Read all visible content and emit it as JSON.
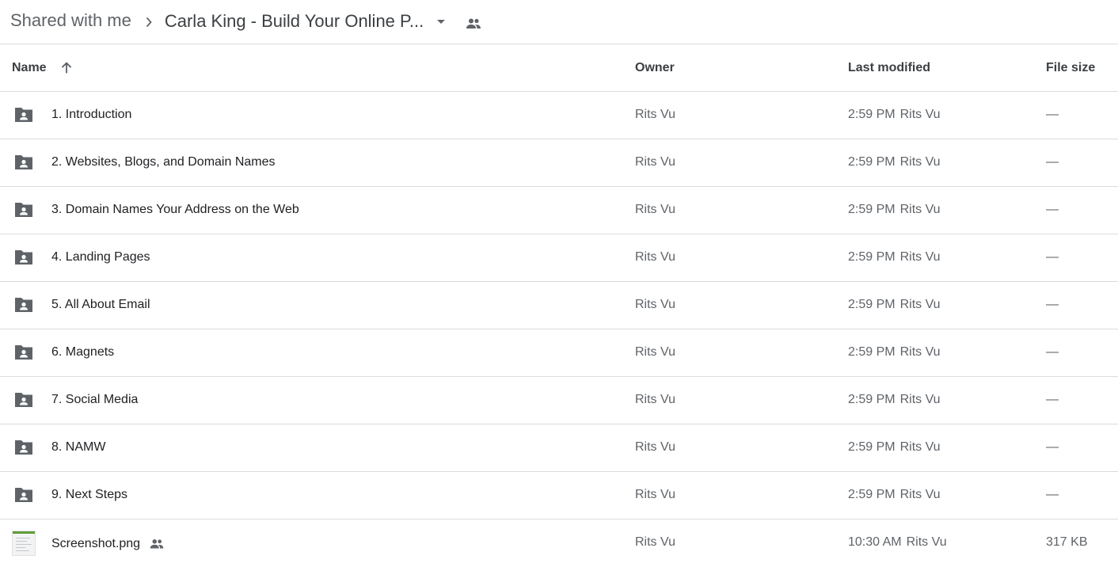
{
  "breadcrumb": {
    "root": "Shared with me",
    "current": "Carla King - Build Your Online P..."
  },
  "columns": {
    "name": "Name",
    "owner": "Owner",
    "last_modified": "Last modified",
    "file_size": "File size"
  },
  "rows": [
    {
      "name": "1. Introduction",
      "owner": "Rits Vu",
      "modified_time": "2:59 PM",
      "modified_by": "Rits Vu",
      "size": "—"
    },
    {
      "name": "2. Websites, Blogs, and Domain Names",
      "owner": "Rits Vu",
      "modified_time": "2:59 PM",
      "modified_by": "Rits Vu",
      "size": "—"
    },
    {
      "name": "3. Domain Names Your Address on the Web",
      "owner": "Rits Vu",
      "modified_time": "2:59 PM",
      "modified_by": "Rits Vu",
      "size": "—"
    },
    {
      "name": "4. Landing Pages",
      "owner": "Rits Vu",
      "modified_time": "2:59 PM",
      "modified_by": "Rits Vu",
      "size": "—"
    },
    {
      "name": "5. All About Email",
      "owner": "Rits Vu",
      "modified_time": "2:59 PM",
      "modified_by": "Rits Vu",
      "size": "—"
    },
    {
      "name": "6. Magnets",
      "owner": "Rits Vu",
      "modified_time": "2:59 PM",
      "modified_by": "Rits Vu",
      "size": "—"
    },
    {
      "name": "7. Social Media",
      "owner": "Rits Vu",
      "modified_time": "2:59 PM",
      "modified_by": "Rits Vu",
      "size": "—"
    },
    {
      "name": "8. NAMW",
      "owner": "Rits Vu",
      "modified_time": "2:59 PM",
      "modified_by": "Rits Vu",
      "size": "—"
    },
    {
      "name": "9. Next Steps",
      "owner": "Rits Vu",
      "modified_time": "2:59 PM",
      "modified_by": "Rits Vu",
      "size": "—"
    },
    {
      "name": "Screenshot.png",
      "owner": "Rits Vu",
      "modified_time": "10:30 AM",
      "modified_by": "Rits Vu",
      "size": "317 KB"
    }
  ],
  "icons": {
    "folder": "shared-folder-icon",
    "people": "people-icon",
    "sort": "arrow-up-icon",
    "chevron": "chevron-right-icon",
    "dropdown": "caret-down-icon"
  },
  "colors": {
    "icon": "#5f6368",
    "divider": "#dadce0",
    "text": "#202124"
  }
}
